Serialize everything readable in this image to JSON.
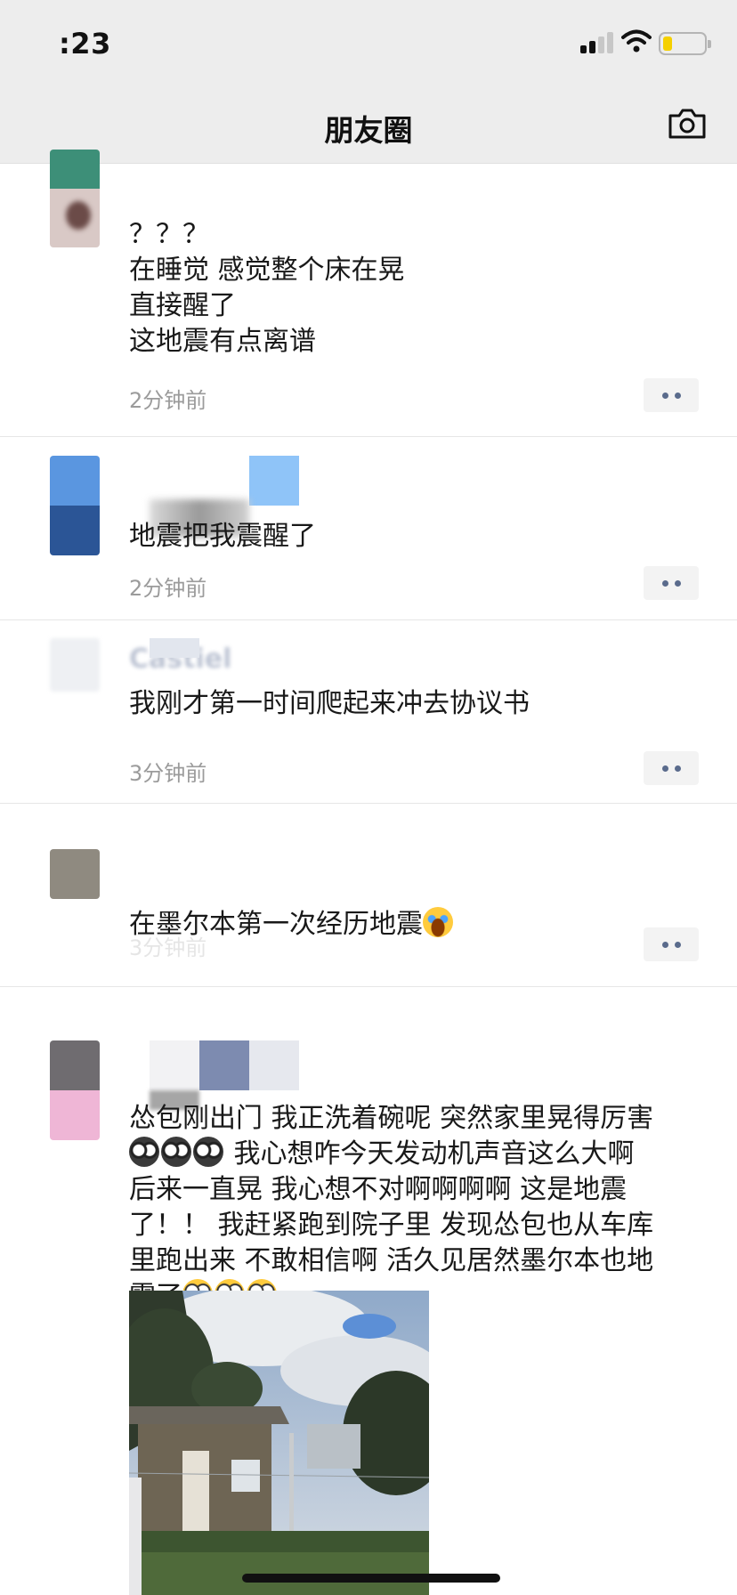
{
  "status_bar": {
    "time": ":23"
  },
  "nav": {
    "title": "朋友圈"
  },
  "posts": [
    {
      "name": "",
      "content": "？？？\n在睡觉 感觉整个床在晃\n直接醒了\n这地震有点离谱",
      "time": "2分钟前"
    },
    {
      "name": "",
      "content": "地震把我震醒了",
      "time": "2分钟前"
    },
    {
      "name": "Castiel",
      "content": "我刚才第一时间爬起来冲去协议书",
      "time": "3分钟前"
    },
    {
      "name": "",
      "content": "在墨尔本第一次经历地震",
      "time": "3分钟前"
    },
    {
      "name": "",
      "content_lines": [
        "怂包刚出门 我正洗着碗呢 突然家里晃得厉害",
        " 我心想咋今天发动机声音这么大啊",
        "后来一直晃 我心想不对啊啊啊啊 这是地震",
        "了！！ 我赶紧跑到院子里 发现怂包也从车库",
        "里跑出来 不敢相信啊 活久见居然墨尔本也地",
        "震了"
      ]
    }
  ],
  "icons": {
    "signal": "cellular-signal-icon",
    "wifi": "wifi-icon",
    "battery": "battery-icon",
    "camera": "camera-icon",
    "more": "more-options-icon"
  },
  "colors": {
    "nav_bg": "#ededed",
    "name_color": "#7b89a8",
    "time_color": "#9b9b9b",
    "battery": "#f5d000"
  }
}
